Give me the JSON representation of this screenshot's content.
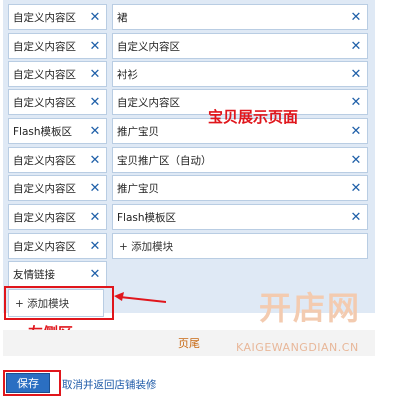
{
  "left_column": [
    {
      "label": "自定义内容区",
      "close": "✕"
    },
    {
      "label": "自定义内容区",
      "close": "✕"
    },
    {
      "label": "自定义内容区",
      "close": "✕"
    },
    {
      "label": "自定义内容区",
      "close": "✕"
    },
    {
      "label": "Flash模板区",
      "close": "✕"
    },
    {
      "label": "自定义内容区",
      "close": "✕"
    },
    {
      "label": "自定义内容区",
      "close": "✕"
    },
    {
      "label": "自定义内容区",
      "close": "✕"
    },
    {
      "label": "自定义内容区",
      "close": "✕"
    },
    {
      "label": "友情链接",
      "close": "✕"
    }
  ],
  "main_column": [
    {
      "label": "裙",
      "close": "✕"
    },
    {
      "label": "自定义内容区",
      "close": "✕"
    },
    {
      "label": "衬衫",
      "close": "✕"
    },
    {
      "label": "自定义内容区",
      "close": "✕"
    },
    {
      "label": "推广宝贝",
      "close": "✕"
    },
    {
      "label": "宝贝推广区（自动）",
      "close": "✕"
    },
    {
      "label": "推广宝贝",
      "close": "✕"
    },
    {
      "label": "Flash模板区",
      "close": "✕"
    }
  ],
  "add_module_main": "+ 添加模块",
  "add_module_left": "+ 添加模块",
  "annotations": {
    "main_area": "宝贝展示页面",
    "left_area": "左侧区"
  },
  "footer_label": "页尾",
  "watermark": {
    "logo": "开店网",
    "url": "KAIGEWANGDIAN.CN"
  },
  "buttons": {
    "save": "保存",
    "cancel": "取消并返回店铺装修"
  },
  "colors": {
    "annotation_red": "#e0161c",
    "panel_bg": "#dfe9f5",
    "save_blue": "#2b6fc2",
    "link_blue": "#1d5aa8",
    "footer_text": "#c86a14"
  }
}
